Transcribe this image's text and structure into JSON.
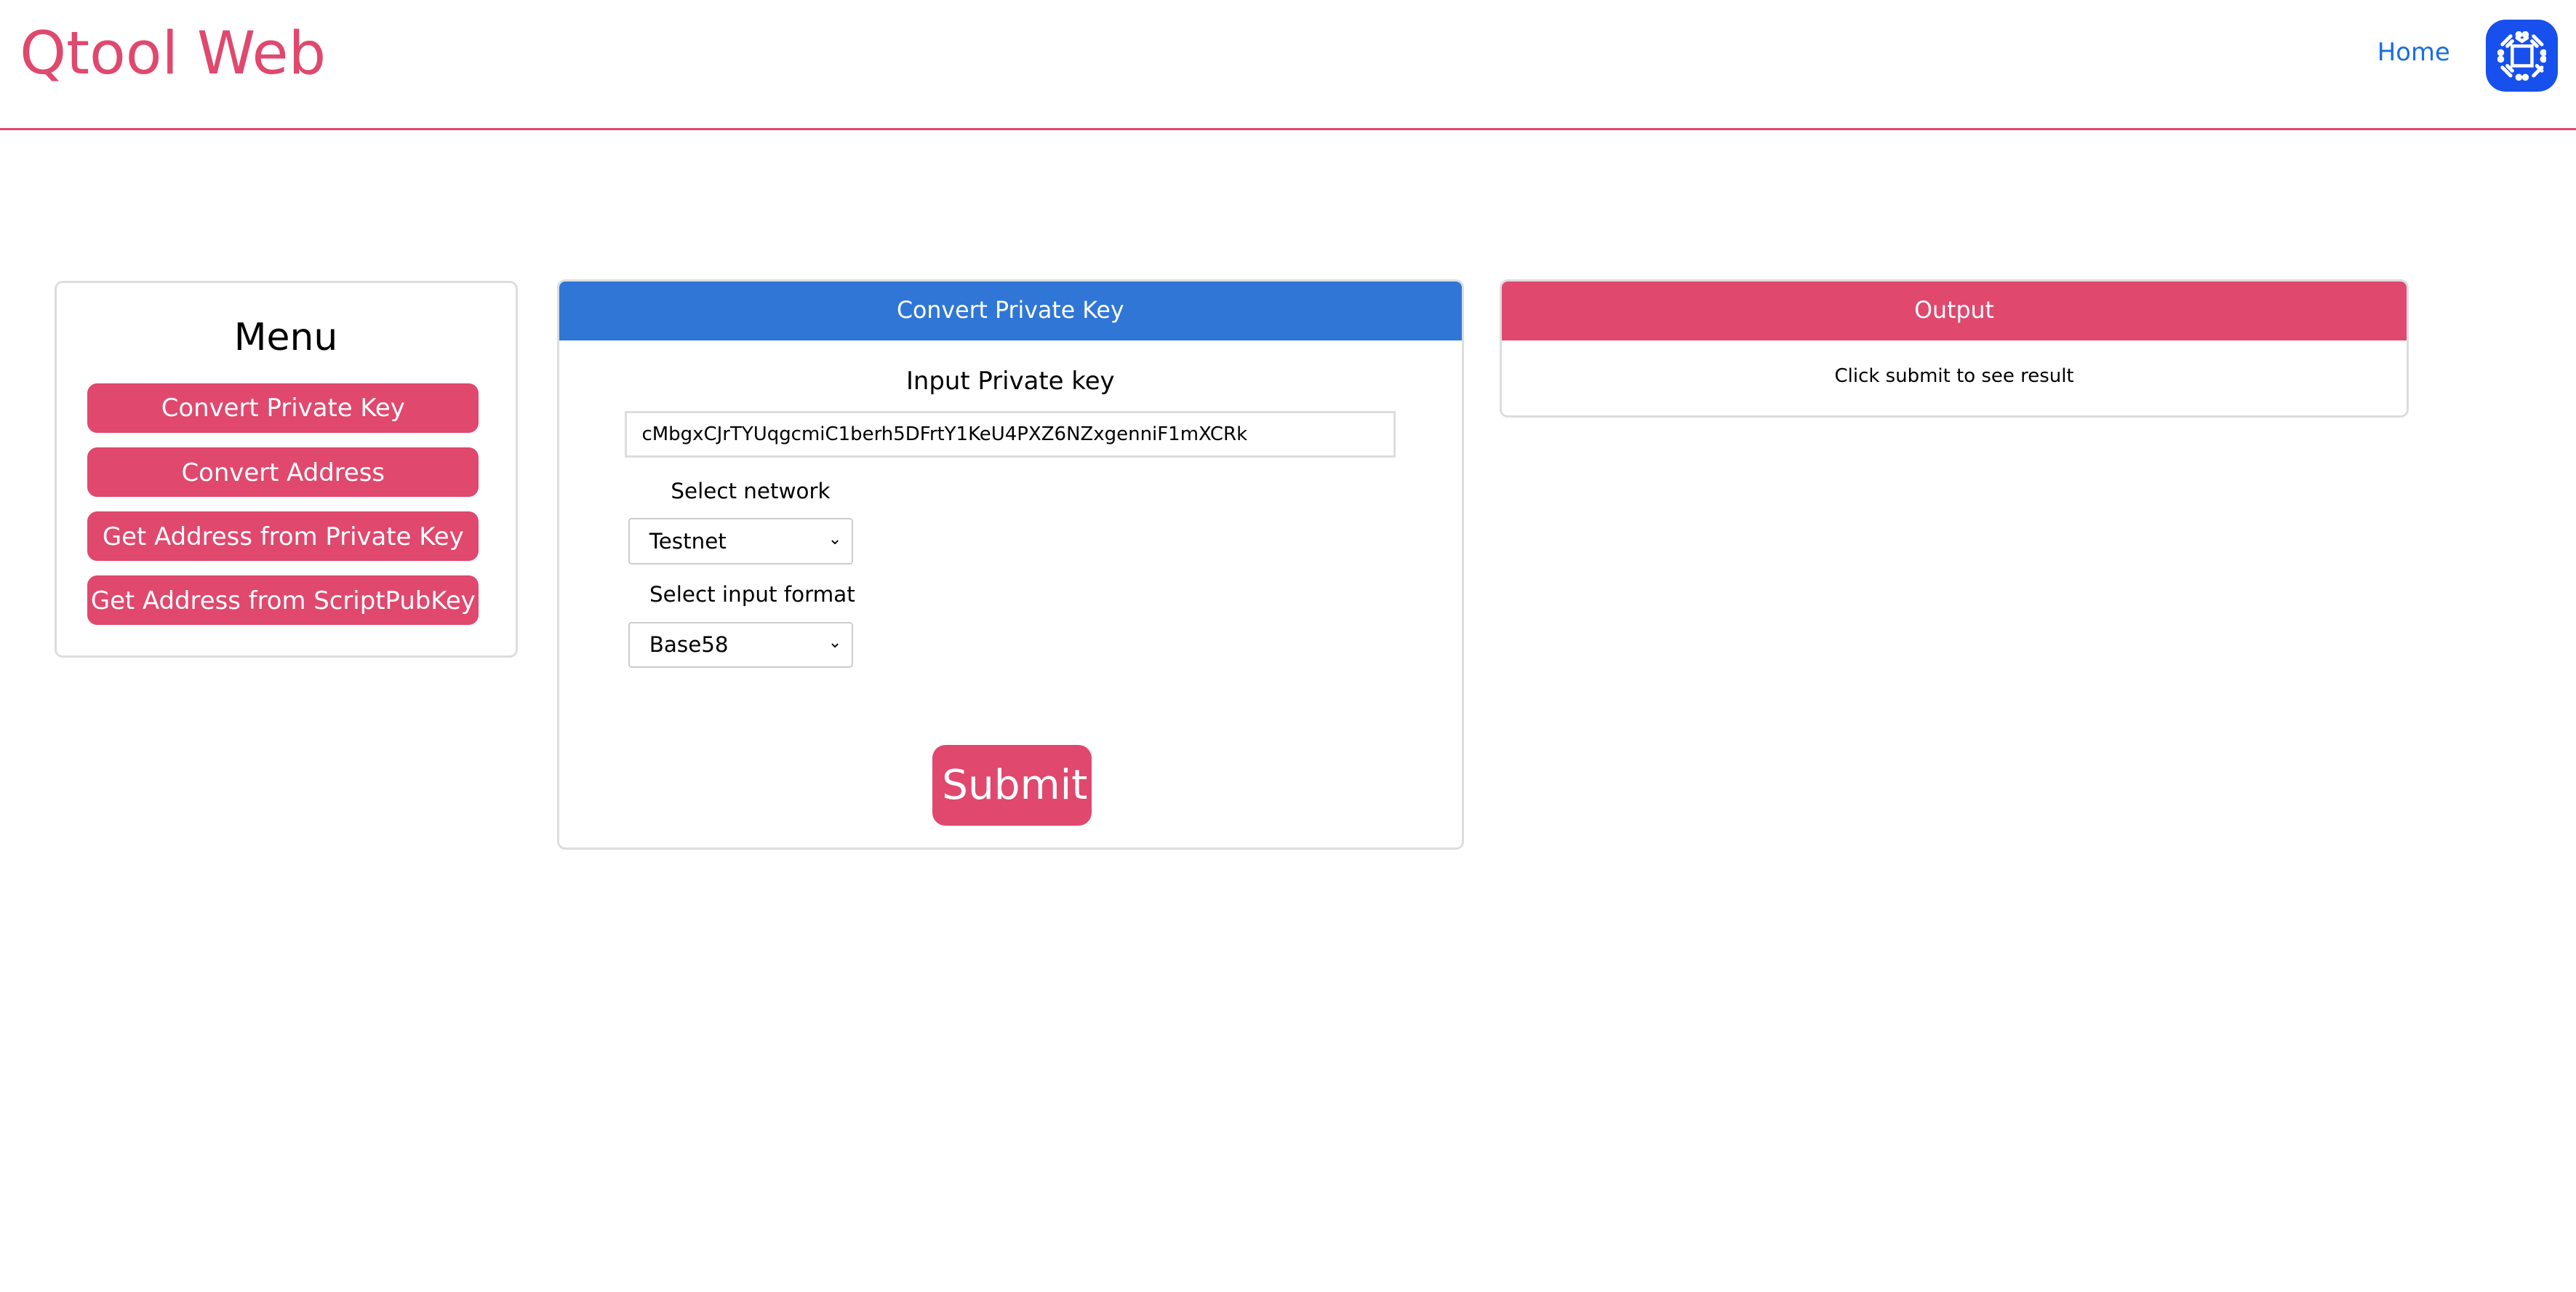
{
  "header": {
    "title": "Qtool Web",
    "home_link": "Home",
    "logo_icon": "qtum-chip-logo"
  },
  "menu": {
    "title": "Menu",
    "items": [
      {
        "label": "Convert Private Key"
      },
      {
        "label": "Convert Address"
      },
      {
        "label": "Get Address from Private Key"
      },
      {
        "label": "Get Address from ScriptPubKey"
      }
    ]
  },
  "form": {
    "header": "Convert Private Key",
    "input_label": "Input Private key",
    "private_key_value": "cMbgxCJrTYUqgcmiC1berh5DFrtY1KeU4PXZ6NZxgenniF1mXCRk",
    "network_label": "Select network",
    "network_value": "Testnet",
    "format_label": "Select input format",
    "format_value": "Base58",
    "submit_label": "Submit"
  },
  "output": {
    "header": "Output",
    "message": "Click submit to see result"
  },
  "colors": {
    "accent": "#e0486e",
    "primary": "#2f76d6",
    "logo": "#1750ec",
    "link": "#1a6ee0"
  }
}
